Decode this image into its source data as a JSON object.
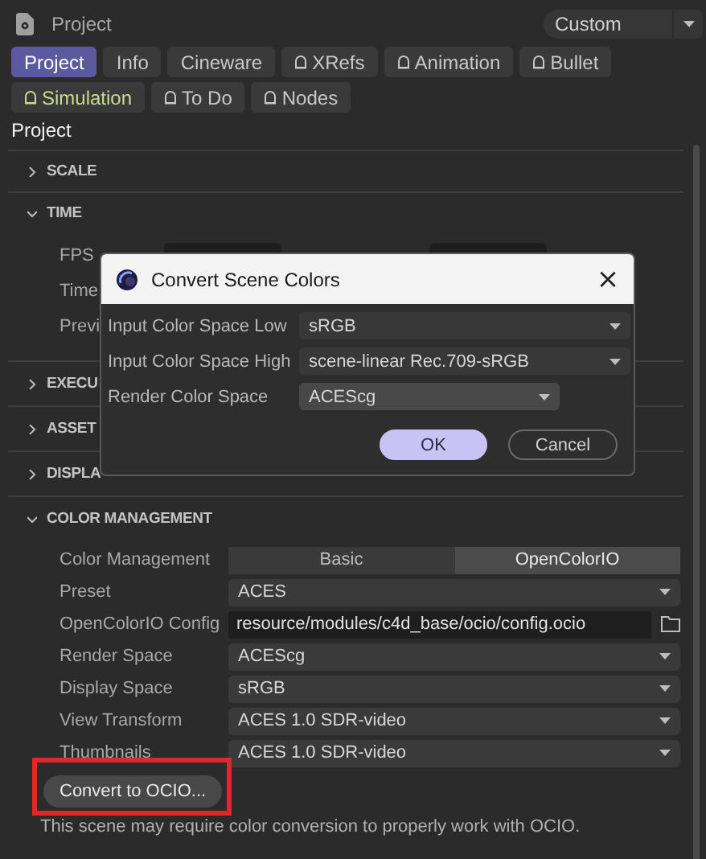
{
  "header": {
    "title": "Project",
    "preset": "Custom"
  },
  "tabs": [
    {
      "label": "Project",
      "selected": true,
      "kind": "plain",
      "highlighted": false
    },
    {
      "label": "Info",
      "selected": false,
      "kind": "plain",
      "highlighted": false
    },
    {
      "label": "Cineware",
      "selected": false,
      "kind": "plain",
      "highlighted": false
    },
    {
      "label": "XRefs",
      "selected": false,
      "kind": "locked",
      "highlighted": false
    },
    {
      "label": "Animation",
      "selected": false,
      "kind": "locked",
      "highlighted": false
    },
    {
      "label": "Bullet",
      "selected": false,
      "kind": "locked",
      "highlighted": false
    },
    {
      "label": "Simulation",
      "selected": false,
      "kind": "locked",
      "highlighted": true
    },
    {
      "label": "To Do",
      "selected": false,
      "kind": "locked",
      "highlighted": false
    },
    {
      "label": "Nodes",
      "selected": false,
      "kind": "locked",
      "highlighted": false
    }
  ],
  "heading": "Project",
  "sections": [
    {
      "title": "SCALE",
      "expanded": false
    },
    {
      "title": "TIME",
      "expanded": true,
      "rows": [
        {
          "label": "FPS",
          "kind": "pair"
        },
        {
          "label": "Time"
        },
        {
          "label": "Previ"
        }
      ]
    },
    {
      "title": "EXECU",
      "expanded": false
    },
    {
      "title": "ASSET",
      "expanded": false
    },
    {
      "title": "DISPLA",
      "expanded": false
    },
    {
      "title": "COLOR MANAGEMENT",
      "expanded": true,
      "settings": [
        {
          "label": "Color Management",
          "kind": "segmented",
          "options": [
            {
              "label": "Basic",
              "selected": false
            },
            {
              "label": "OpenColorIO",
              "selected": true
            }
          ]
        },
        {
          "label": "Preset",
          "kind": "dropdown",
          "value": "ACES"
        },
        {
          "label": "OpenColorIO Config",
          "kind": "path",
          "value": "resource/modules/c4d_base/ocio/config.ocio"
        },
        {
          "label": "Render Space",
          "kind": "dropdown",
          "value": "ACEScg"
        },
        {
          "label": "Display Space",
          "kind": "dropdown",
          "value": "sRGB"
        },
        {
          "label": "View Transform",
          "kind": "dropdown",
          "value": "ACES 1.0 SDR-video"
        },
        {
          "label": "Thumbnails",
          "kind": "dropdown",
          "value": "ACES 1.0 SDR-video"
        }
      ],
      "button": "Convert to OCIO...",
      "note": "This scene may require color conversion to properly work with OCIO."
    }
  ],
  "dialog": {
    "title": "Convert Scene Colors",
    "close": "×",
    "fields": [
      {
        "label": "Input Color Space Low",
        "value": "sRGB",
        "wide": true
      },
      {
        "label": "Input Color Space High",
        "value": "scene-linear Rec.709-sRGB",
        "wide": true
      },
      {
        "label": "Render Color Space",
        "value": "ACEScg",
        "wide": false
      }
    ],
    "buttons": [
      {
        "label": "OK",
        "kind": "primary"
      },
      {
        "label": "Cancel",
        "kind": "secondary"
      }
    ]
  }
}
